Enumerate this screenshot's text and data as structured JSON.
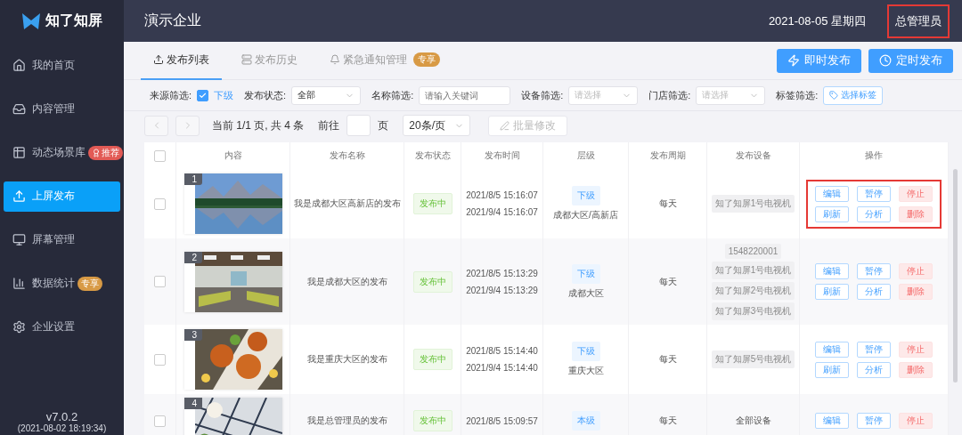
{
  "sidebar": {
    "logo": "知了知屏",
    "items": [
      {
        "label": "我的首页",
        "selected": false
      },
      {
        "label": "内容管理",
        "selected": false
      },
      {
        "label": "动态场景库",
        "selected": false,
        "badge": {
          "text": "推荐",
          "kind": "recommend"
        }
      },
      {
        "label": "上屏发布",
        "selected": true
      },
      {
        "label": "屏幕管理",
        "selected": false
      },
      {
        "label": "数据统计",
        "selected": false,
        "badge": {
          "text": "专享",
          "kind": "vip"
        }
      },
      {
        "label": "企业设置",
        "selected": false
      }
    ],
    "version": "v7.0.2",
    "build": "(2021-08-02 18:19:34)"
  },
  "header": {
    "title": "演示企业",
    "date": "2021-08-05 星期四",
    "user": {
      "name": "总管理员",
      "highlighted": true
    }
  },
  "tabs": [
    {
      "label": "发布列表",
      "selected": true
    },
    {
      "label": "发布历史",
      "selected": false
    },
    {
      "label": "紧急通知管理",
      "selected": false,
      "badge": "专享"
    }
  ],
  "actions": [
    {
      "label": "即时发布"
    },
    {
      "label": "定时发布"
    }
  ],
  "filters": [
    {
      "kind": "checkbox",
      "label": "来源筛选:",
      "text": "下级",
      "checked": true
    },
    {
      "kind": "select",
      "label": "发布状态:",
      "value": "全部"
    },
    {
      "kind": "input",
      "label": "名称筛选:",
      "placeholder": "请输入关键词"
    },
    {
      "kind": "select",
      "label": "设备筛选:",
      "placeholder": "请选择"
    },
    {
      "kind": "select",
      "label": "门店筛选:",
      "placeholder": "请选择"
    },
    {
      "kind": "tag",
      "label": "标签筛选:",
      "text": "选择标签"
    }
  ],
  "pagination": {
    "info": "当前 1/1 页, 共 4 条",
    "goto": "前往",
    "page_unit": "页",
    "page_size": "20条/页",
    "batch": "批量修改",
    "batch_disabled": true
  },
  "table": {
    "all_checked": false,
    "columns": [
      "内容",
      "发布名称",
      "发布状态",
      "发布时间",
      "层级",
      "发布周期",
      "发布设备",
      "操作"
    ],
    "rows": [
      {
        "checked": false,
        "index": "1",
        "name": "我是成都大区高新店的发布",
        "status": "发布中",
        "times": [
          "2021/8/5 15:16:07",
          "2021/9/4 15:16:07"
        ],
        "level_tag": "下级",
        "level_text": "成都大区/高新店",
        "period": "每天",
        "devices": [
          {
            "text": "知了知屏1号电视机",
            "kind": "chip"
          }
        ],
        "highlighted": true,
        "ops": [
          {
            "label": "编辑",
            "kind": "primary"
          },
          {
            "label": "暂停",
            "kind": "primary"
          },
          {
            "label": "停止",
            "kind": "danger"
          },
          {
            "label": "刷新",
            "kind": "primary"
          },
          {
            "label": "分析",
            "kind": "primary"
          },
          {
            "label": "删除",
            "kind": "danger"
          }
        ]
      },
      {
        "checked": false,
        "index": "2",
        "name": "我是成都大区的发布",
        "status": "发布中",
        "times": [
          "2021/8/5 15:13:29",
          "2021/9/4 15:13:29"
        ],
        "level_tag": "下级",
        "level_text": "成都大区",
        "period": "每天",
        "devices": [
          {
            "text": "1548220001",
            "kind": "chip"
          },
          {
            "text": "知了知屏1号电视机",
            "kind": "chip"
          },
          {
            "text": "知了知屏2号电视机",
            "kind": "chip"
          },
          {
            "text": "知了知屏3号电视机",
            "kind": "chip"
          }
        ],
        "highlighted": false,
        "ops": [
          {
            "label": "编辑",
            "kind": "primary"
          },
          {
            "label": "暂停",
            "kind": "primary"
          },
          {
            "label": "停止",
            "kind": "danger"
          },
          {
            "label": "刷新",
            "kind": "primary"
          },
          {
            "label": "分析",
            "kind": "primary"
          },
          {
            "label": "删除",
            "kind": "danger"
          }
        ]
      },
      {
        "checked": false,
        "index": "3",
        "name": "我是重庆大区的发布",
        "status": "发布中",
        "times": [
          "2021/8/5 15:14:40",
          "2021/9/4 15:14:40"
        ],
        "level_tag": "下级",
        "level_text": "重庆大区",
        "period": "每天",
        "devices": [
          {
            "text": "知了知屏5号电视机",
            "kind": "chip"
          }
        ],
        "highlighted": false,
        "ops": [
          {
            "label": "编辑",
            "kind": "primary"
          },
          {
            "label": "暂停",
            "kind": "primary"
          },
          {
            "label": "停止",
            "kind": "danger"
          },
          {
            "label": "刷新",
            "kind": "primary"
          },
          {
            "label": "分析",
            "kind": "primary"
          },
          {
            "label": "删除",
            "kind": "danger"
          }
        ]
      },
      {
        "checked": false,
        "index": "4",
        "name": "我是总管理员的发布",
        "status": "发布中",
        "times": [
          "2021/8/5 15:09:57"
        ],
        "level_tag": "本级",
        "period": "每天",
        "devices": [
          {
            "text": "全部设备",
            "kind": "plain"
          }
        ],
        "highlighted": false,
        "ops": [
          {
            "label": "编辑",
            "kind": "primary"
          },
          {
            "label": "暂停",
            "kind": "primary"
          },
          {
            "label": "停止",
            "kind": "danger"
          }
        ]
      }
    ]
  }
}
